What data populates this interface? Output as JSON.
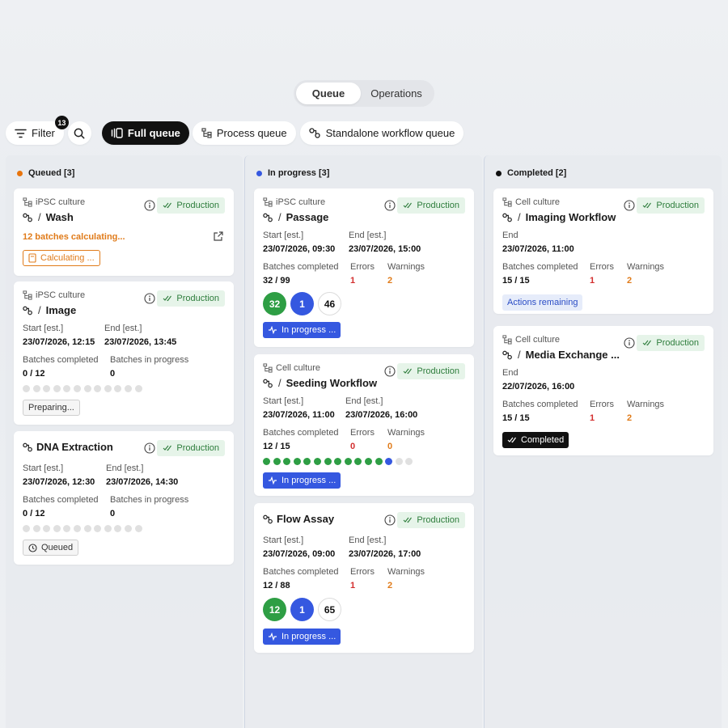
{
  "tabs": [
    {
      "label": "Queue",
      "active": true
    },
    {
      "label": "Operations",
      "active": false
    }
  ],
  "toolbar": {
    "filter_label": "Filter",
    "filter_count": "13",
    "full_queue_label": "Full queue",
    "process_queue_label": "Process queue",
    "standalone_label": "Standalone workflow queue"
  },
  "columns": {
    "queued": {
      "title": "Queued [3]",
      "color": "#e8740c"
    },
    "in_progress": {
      "title": "In progress [3]",
      "color": "#3558e0"
    },
    "completed": {
      "title": "Completed [2]",
      "color": "#111111"
    }
  },
  "labels": {
    "start": "Start [est.]",
    "end_est": "End [est.]",
    "end": "End",
    "batches_completed": "Batches completed",
    "batches_in_progress": "Batches in progress",
    "errors": "Errors",
    "warnings": "Warnings",
    "production": "Production",
    "slash": "/"
  },
  "cards": {
    "wash": {
      "process": "iPSC culture",
      "name": "Wash",
      "notice": "12 batches calculating...",
      "status": "Calculating ..."
    },
    "image": {
      "process": "iPSC culture",
      "name": "Image",
      "start": "23/07/2026, 12:15",
      "end": "23/07/2026, 13:45",
      "completed": "0 / 12",
      "in_progress": "0",
      "dots": {
        "done": 0,
        "active": 0,
        "total": 12
      },
      "status": "Preparing..."
    },
    "dna": {
      "name": "DNA Extraction",
      "start": "23/07/2026, 12:30",
      "end": "23/07/2026, 14:30",
      "completed": "0 / 12",
      "in_progress": "0",
      "dots": {
        "done": 0,
        "active": 0,
        "total": 12
      },
      "status": "Queued"
    },
    "passage": {
      "process": "iPSC culture",
      "name": "Passage",
      "start": "23/07/2026, 09:30",
      "end": "23/07/2026, 15:00",
      "completed": "32 / 99",
      "errors": "1",
      "warnings": "2",
      "done_count": "32",
      "active_count": "1",
      "pending_count": "46",
      "status": "In progress ..."
    },
    "seeding": {
      "process": "Cell culture",
      "name": "Seeding Workflow",
      "start": "23/07/2026, 11:00",
      "end": "23/07/2026, 16:00",
      "completed": "12 / 15",
      "errors": "0",
      "warnings": "0",
      "dots": {
        "done": 12,
        "active": 1,
        "total": 15
      },
      "status": "In progress ..."
    },
    "flow": {
      "name": "Flow Assay",
      "start": "23/07/2026, 09:00",
      "end": "23/07/2026, 17:00",
      "completed": "12 / 88",
      "errors": "1",
      "warnings": "2",
      "done_count": "12",
      "active_count": "1",
      "pending_count": "65",
      "status": "In progress ..."
    },
    "imaging": {
      "process": "Cell culture",
      "name": "Imaging Workflow",
      "end": "23/07/2026, 11:00",
      "completed": "15 / 15",
      "errors": "1",
      "warnings": "2",
      "status": "Actions remaining"
    },
    "media": {
      "process": "Cell culture",
      "name": "Media Exchange ...",
      "end": "22/07/2026, 16:00",
      "completed": "15 / 15",
      "errors": "1",
      "warnings": "2",
      "status": "Completed"
    }
  },
  "colors": {
    "green": "#2e9e44",
    "blue": "#3558e0",
    "gray": "#e0e0e0",
    "orange": "#e07b1a",
    "red": "#d32f2f"
  }
}
